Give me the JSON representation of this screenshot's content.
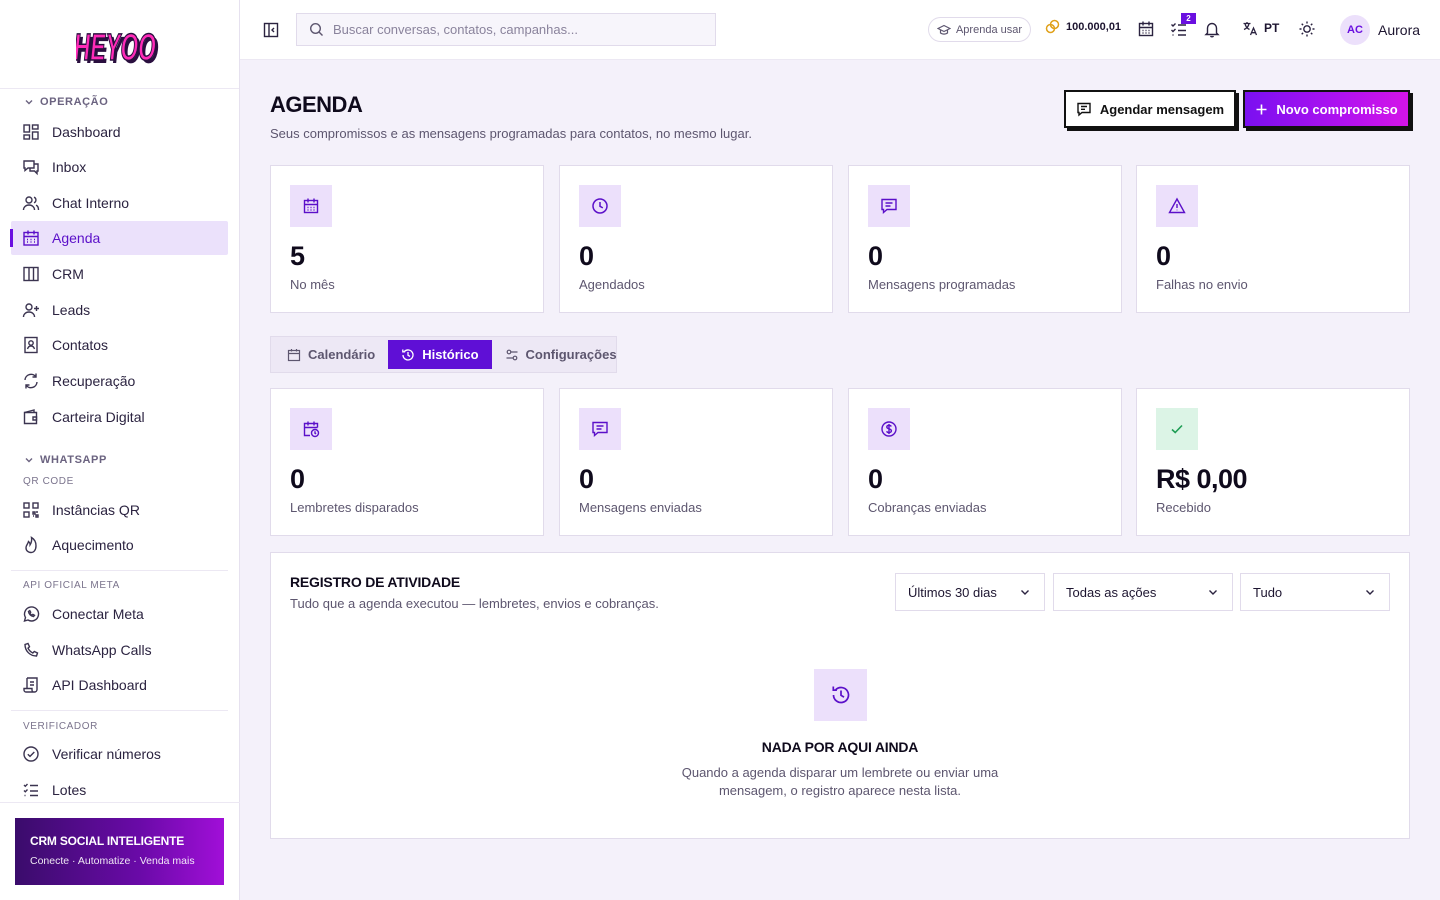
{
  "brand": {
    "logo_text": "HEYOO",
    "accent": "#6a0fe0",
    "logo_pink": "#ff2bb8"
  },
  "sidebar": {
    "sections": [
      {
        "title": "OPERAÇÃO",
        "items": [
          "Dashboard",
          "Inbox",
          "Chat Interno",
          "Agenda",
          "CRM",
          "Leads",
          "Contatos",
          "Recuperação",
          "Carteira Digital"
        ]
      },
      {
        "title": "WHATSAPP",
        "subtitle": "QR CODE",
        "items": [
          "Instâncias QR",
          "Aquecimento"
        ]
      },
      {
        "subtitle": "API OFICIAL META",
        "items": [
          "Conectar Meta",
          "WhatsApp Calls",
          "API Dashboard"
        ]
      },
      {
        "subtitle": "VERIFICADOR",
        "items": [
          "Verificar números",
          "Lotes"
        ]
      }
    ],
    "active_item": "Agenda",
    "promo": {
      "title": "CRM SOCIAL INTELIGENTE",
      "tagline": "Conecte · Automatize · Venda mais"
    }
  },
  "topbar": {
    "search_placeholder": "Buscar conversas, contatos, campanhas...",
    "learn_label": "Aprenda usar",
    "credits": "100.000,01",
    "tasks_badge": "2",
    "language": "PT",
    "user": {
      "initials": "AC",
      "name": "Aurora"
    }
  },
  "page": {
    "title": "AGENDA",
    "subtitle": "Seus compromissos e as mensagens programadas para contatos, no mesmo lugar.",
    "btn_schedule": "Agendar mensagem",
    "btn_new": "Novo compromisso"
  },
  "stats_top": [
    {
      "value": "5",
      "label": "No mês",
      "icon": "calendar-icon"
    },
    {
      "value": "0",
      "label": "Agendados",
      "icon": "clock-icon"
    },
    {
      "value": "0",
      "label": "Mensagens programadas",
      "icon": "message-icon"
    },
    {
      "value": "0",
      "label": "Falhas no envio",
      "icon": "warning-icon"
    }
  ],
  "tabs": [
    {
      "label": "Calendário",
      "icon": "calendar-icon"
    },
    {
      "label": "Histórico",
      "icon": "history-icon",
      "active": true
    },
    {
      "label": "Configurações",
      "icon": "settings-icon"
    }
  ],
  "stats_history": [
    {
      "value": "0",
      "label": "Lembretes disparados",
      "icon": "calendar-clock-icon"
    },
    {
      "value": "0",
      "label": "Mensagens enviadas",
      "icon": "message-icon"
    },
    {
      "value": "0",
      "label": "Cobranças enviadas",
      "icon": "dollar-icon"
    },
    {
      "value": "R$ 0,00",
      "label": "Recebido",
      "icon": "check-icon"
    }
  ],
  "activity": {
    "title": "REGISTRO DE ATIVIDADE",
    "subtitle": "Tudo que a agenda executou — lembretes, envios e cobranças.",
    "filters": [
      "Últimos 30 dias",
      "Todas as ações",
      "Tudo"
    ],
    "empty_title": "NADA POR AQUI AINDA",
    "empty_desc": "Quando a agenda disparar um lembrete ou enviar uma mensagem, o registro aparece nesta lista."
  }
}
